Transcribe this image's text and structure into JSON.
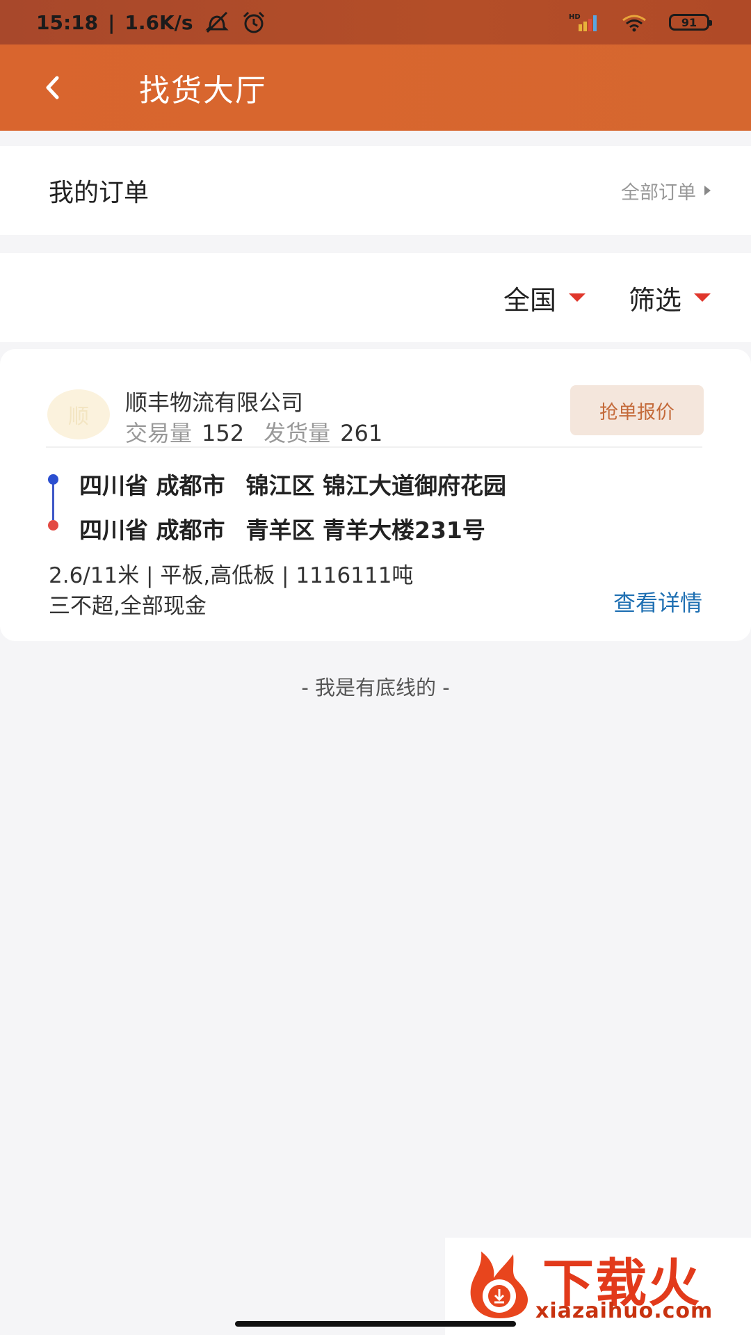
{
  "status_bar": {
    "time": "15:18",
    "network_speed": "1.6K/s",
    "battery_level": "91",
    "icons": [
      "mute-icon",
      "alarm-icon",
      "hd-signal-icon",
      "wifi-icon",
      "battery-icon"
    ]
  },
  "header": {
    "title": "找货大厅",
    "back_icon": "chevron-left-icon"
  },
  "orders": {
    "title": "我的订单",
    "all_label": "全部订单"
  },
  "filters": {
    "region": "全国",
    "filter": "筛选"
  },
  "order_card": {
    "avatar_text": "顺",
    "company": "顺丰物流有限公司",
    "trade_label": "交易量",
    "trade_count": "152",
    "ship_label": "发货量",
    "ship_count": "261",
    "grab_button": "抢单报价",
    "origin": {
      "province_city": "四川省 成都市",
      "detail": "锦江区 锦江大道御府花园"
    },
    "destination": {
      "province_city": "四川省 成都市",
      "detail": "青羊区 青羊大楼231号"
    },
    "spec": "2.6/11米 | 平板,高低板 | 1116111吨",
    "terms": "三不超,全部现金",
    "detail_link": "查看详情"
  },
  "footer_note": "- 我是有底线的 -",
  "watermark": {
    "title": "下载火",
    "url": "xiazaihuo.com"
  },
  "colors": {
    "header": "#d9652e",
    "status_bar": "#a8482b",
    "accent_red": "#e0372c",
    "link_blue": "#1e6fb2",
    "route_blue": "#2b4fd0",
    "route_red": "#e34a43"
  }
}
